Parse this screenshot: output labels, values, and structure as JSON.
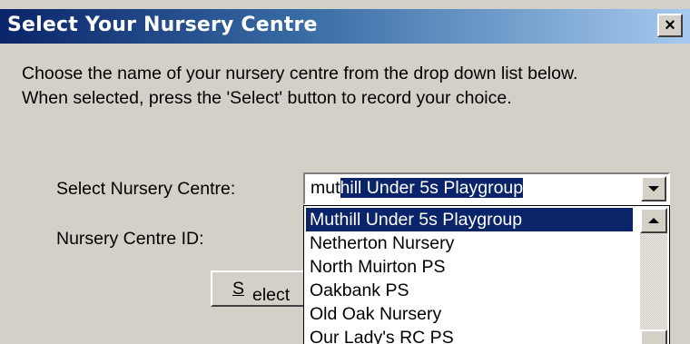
{
  "dialog": {
    "title": "Select Your Nursery Centre",
    "close_glyph": "×",
    "intro_line1": "Choose the name of your nursery centre from the drop down list below.",
    "intro_line2": "When selected, press the 'Select' button to record your choice."
  },
  "form": {
    "centre_label": "Select Nursery Centre:",
    "centre_id_label": "Nursery Centre ID:",
    "combo": {
      "typed": "mut",
      "autocomplete": "hill Under 5s Playgroup"
    },
    "select_button": {
      "mnemonic": "S",
      "rest": "elect"
    }
  },
  "dropdown": {
    "options": [
      "Muthill Under 5s Playgroup",
      "Netherton Nursery",
      "North Muirton PS",
      "Oakbank PS",
      "Old Oak Nursery",
      "Our Lady's RC PS"
    ],
    "selected_index": 0
  },
  "icons": {
    "close": "close-icon",
    "dropdown_arrow": "chevron-down-icon",
    "scroll_up": "chevron-up-icon"
  },
  "colors": {
    "title_bar_start": "#0a246a",
    "title_bar_end": "#a6caf0",
    "selection": "#0a246a",
    "dialog_face": "#d4d0c8"
  }
}
